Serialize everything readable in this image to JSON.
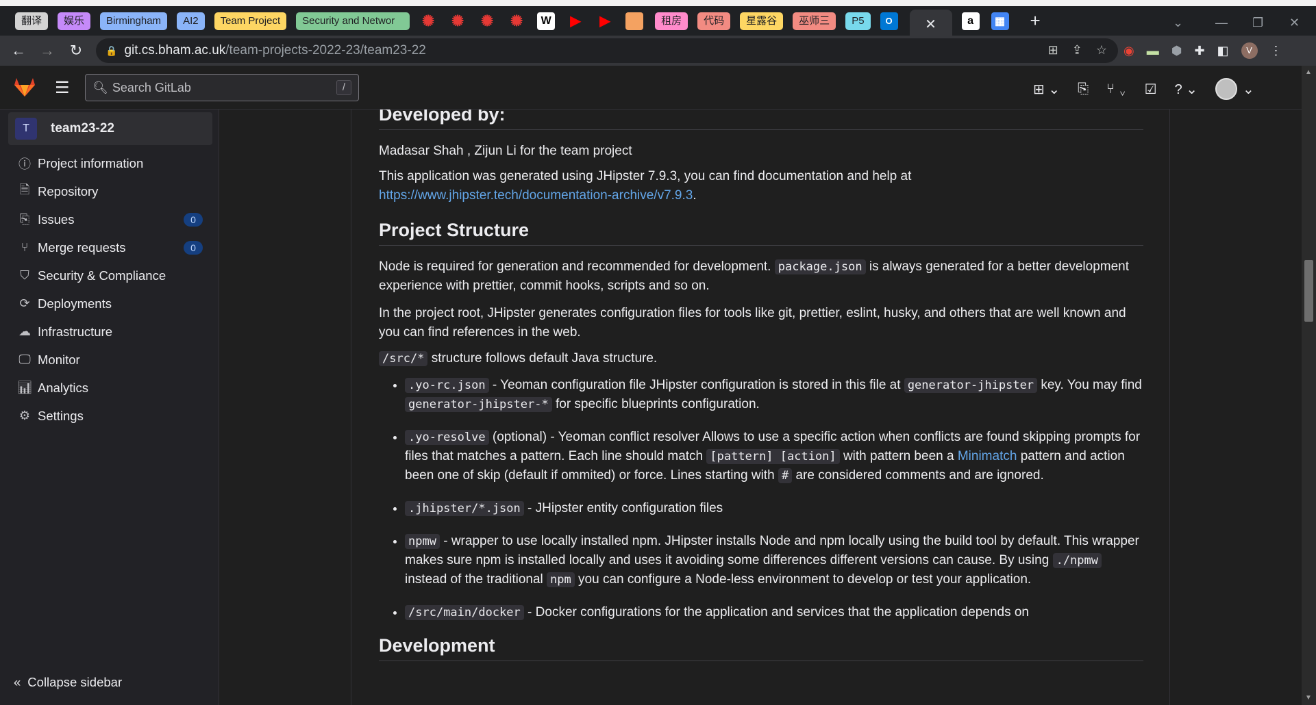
{
  "browser": {
    "tabs": [
      {
        "label": "翻译",
        "color": "#d3d3d3"
      },
      {
        "label": "娱乐",
        "color": "#c58af9"
      },
      {
        "label": "Birmingham",
        "color": "#8ab4f8"
      },
      {
        "label": "AI2",
        "color": "#8ab4f8"
      },
      {
        "label": "Team Project",
        "color": "#fdd663"
      },
      {
        "label": "Security and Networ",
        "color": "#81c995"
      },
      {
        "label": "租房",
        "color": "#ff8bcb"
      },
      {
        "label": "代码",
        "color": "#f28b82"
      },
      {
        "label": "星露谷",
        "color": "#fdd663"
      },
      {
        "label": "巫师三",
        "color": "#f28b82"
      },
      {
        "label": "P5",
        "color": "#78d9ec"
      }
    ],
    "favicons": {
      "wiki": "W",
      "amazon": "a"
    },
    "new_tab": "+",
    "close_tab": "✕",
    "url_host": "git.cs.bham.ac.uk",
    "url_path": "/team-projects-2022-23/team23-22",
    "profile_initial": "V"
  },
  "gitlab": {
    "search_placeholder": "Search GitLab",
    "search_shortcut": "/"
  },
  "sidebar": {
    "project_initial": "T",
    "project_name": "team23-22",
    "items": [
      {
        "label": "Project information",
        "icon": "project-icon"
      },
      {
        "label": "Repository",
        "icon": "doc-icon"
      },
      {
        "label": "Issues",
        "icon": "issues-icon",
        "badge": "0"
      },
      {
        "label": "Merge requests",
        "icon": "merge-request-icon",
        "badge": "0"
      },
      {
        "label": "Security & Compliance",
        "icon": "shield-icon"
      },
      {
        "label": "Deployments",
        "icon": "deployments-icon"
      },
      {
        "label": "Infrastructure",
        "icon": "cloud-icon"
      },
      {
        "label": "Monitor",
        "icon": "monitor-icon"
      },
      {
        "label": "Analytics",
        "icon": "chart-icon"
      },
      {
        "label": "Settings",
        "icon": "gear-icon"
      }
    ],
    "collapse_label": "Collapse sidebar"
  },
  "readme": {
    "developed_by_heading": "Developed by:",
    "developers": "Madasar Shah , Zijun Li for the team project",
    "generated_text": "This application was generated using JHipster 7.9.3, you can find documentation and help at",
    "generated_link": "https://www.jhipster.tech/documentation-archive/v7.9.3",
    "structure_heading": "Project Structure",
    "node_text_1": "Node is required for generation and recommended for development.",
    "node_code": "package.json",
    "node_text_2": "is always generated for a better development experience with prettier, commit hooks, scripts and so on.",
    "root_text": "In the project root, JHipster generates configuration files for tools like git, prettier, eslint, husky, and others that are well known and you can find references in the web.",
    "src_code": "/src/*",
    "src_text": "structure follows default Java structure.",
    "item1": {
      "code": ".yo-rc.json",
      "text_a": "- Yeoman configuration file JHipster configuration is stored in this file at",
      "code_b": "generator-jhipster",
      "text_b": "key. You may find",
      "code_c": "generator-jhipster-*",
      "text_c": "for specific blueprints configuration."
    },
    "item2": {
      "code": ".yo-resolve",
      "text_a": "(optional) - Yeoman conflict resolver Allows to use a specific action when conflicts are found skipping prompts for files that matches a pattern. Each line should match",
      "code_b": "[pattern] [action]",
      "text_b": "with pattern been a",
      "link": "Minimatch",
      "text_c": "pattern and action been one of skip (default if ommited) or force. Lines starting with",
      "code_d": "#",
      "text_d": "are considered comments and are ignored."
    },
    "item3": {
      "code": ".jhipster/*.json",
      "text_a": "- JHipster entity configuration files"
    },
    "item4": {
      "code": "npmw",
      "text_a": "- wrapper to use locally installed npm. JHipster installs Node and npm locally using the build tool by default. This wrapper makes sure npm is installed locally and uses it avoiding some differences different versions can cause. By using",
      "code_b": "./npmw",
      "text_b": "instead of the traditional",
      "code_c": "npm",
      "text_c": "you can configure a Node-less environment to develop or test your application."
    },
    "item5": {
      "code": "/src/main/docker",
      "text_a": "- Docker configurations for the application and services that the application depends on"
    },
    "development_heading": "Development"
  }
}
